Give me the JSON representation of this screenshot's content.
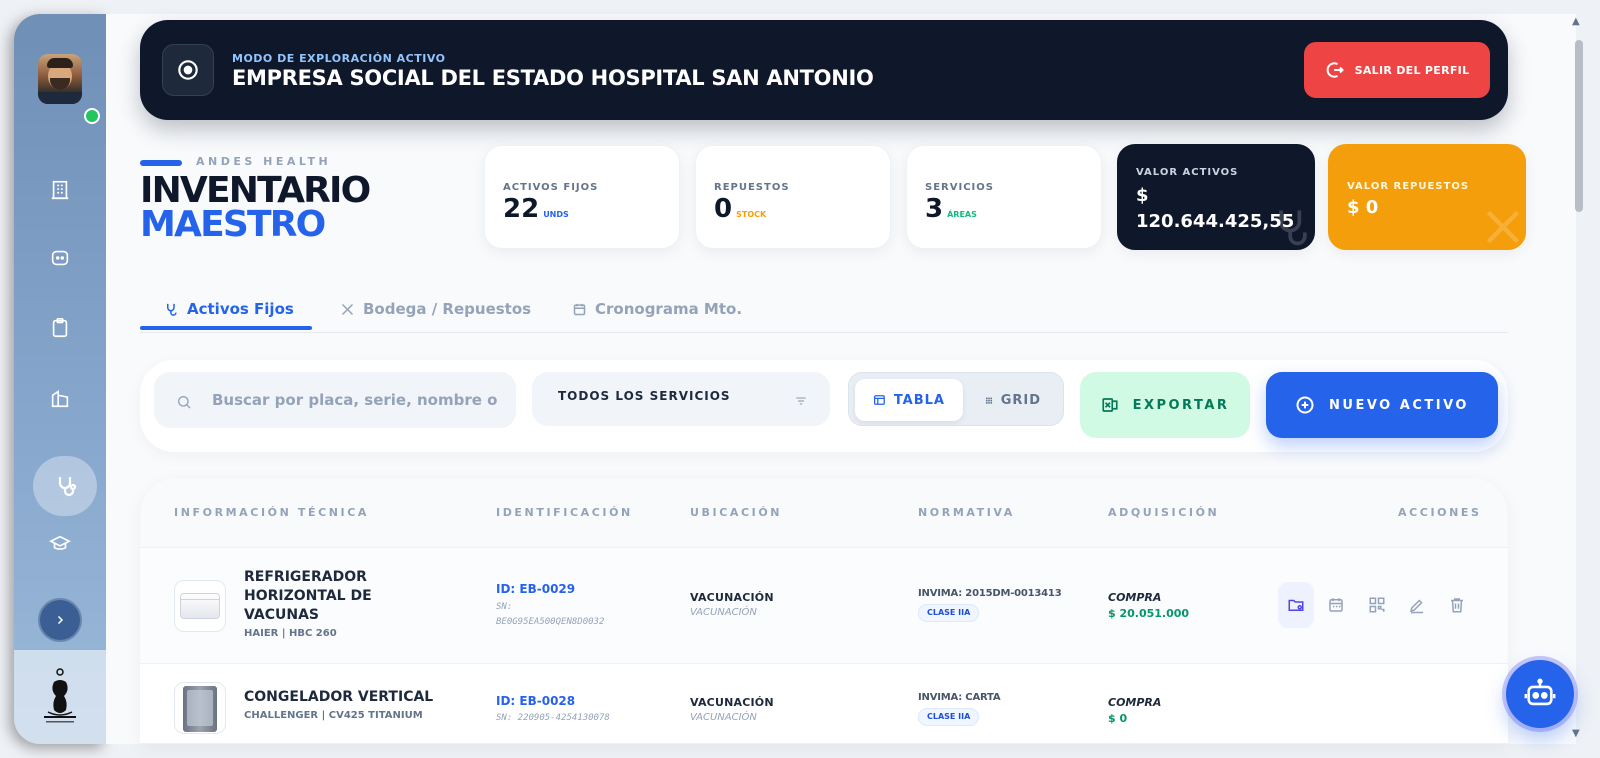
{
  "banner": {
    "mode_label": "MODO DE EXPLORACIÓN ACTIVO",
    "entity_name": "EMPRESA SOCIAL DEL ESTADO HOSPITAL SAN ANTONIO",
    "exit_label": "SALIR DEL PERFIL"
  },
  "header": {
    "brand": "ANDES HEALTH",
    "title_line1": "INVENTARIO",
    "title_line2": "MAESTRO"
  },
  "stats": [
    {
      "label": "ACTIVOS FIJOS",
      "value": "22",
      "unit": "UNDS",
      "unit_color": "#2563eb"
    },
    {
      "label": "REPUESTOS",
      "value": "0",
      "unit": "STOCK",
      "unit_color": "#f59e0b"
    },
    {
      "label": "SERVICIOS",
      "value": "3",
      "unit": "ÁREAS",
      "unit_color": "#10b981"
    },
    {
      "label": "VALOR ACTIVOS",
      "value_line1": "$",
      "value_line2": "120.644.425,55"
    },
    {
      "label": "VALOR REPUESTOS",
      "value": "$ 0"
    }
  ],
  "tabs": [
    {
      "label": "Activos Fijos",
      "icon": "stethoscope-icon",
      "active": true
    },
    {
      "label": "Bodega / Repuestos",
      "icon": "tools-icon",
      "active": false
    },
    {
      "label": "Cronograma Mto.",
      "icon": "calendar-icon",
      "active": false
    }
  ],
  "toolbar": {
    "search_placeholder": "Buscar por placa, serie, nombre o modelo...",
    "service_filter": "TODOS LOS SERVICIOS",
    "view_table": "TABLA",
    "view_grid": "GRID",
    "export_label": "EXPORTAR",
    "new_label": "NUEVO ACTIVO"
  },
  "table": {
    "columns": [
      "INFORMACIÓN TÉCNICA",
      "IDENTIFICACIÓN",
      "UBICACIÓN",
      "NORMATIVA",
      "ADQUISICIÓN",
      "ACCIONES"
    ],
    "rows": [
      {
        "name_lines": [
          "REFRIGERADOR",
          "HORIZONTAL DE",
          "VACUNAS"
        ],
        "brand_model": "HAIER | HBC 260",
        "id": "ID: EB-0029",
        "sn_label": "SN:",
        "sn": "BE0G95EA500QEN8D0032",
        "location": "VACUNACIÓN",
        "location_sub": "VACUNACIÓN",
        "invima": "INVIMA: 2015DM-0013413",
        "risk_class": "CLASE IIA",
        "acquisition": "COMPRA",
        "price": "$ 20.051.000"
      },
      {
        "name_lines": [
          "CONGELADOR VERTICAL"
        ],
        "brand_model": "CHALLENGER | CV425 TITANIUM",
        "id": "ID: EB-0028",
        "sn": "SN: 220905-4254130078",
        "location": "VACUNACIÓN",
        "location_sub": "VACUNACIÓN",
        "invima": "INVIMA: CARTA",
        "risk_class": "CLASE IIA",
        "acquisition": "COMPRA",
        "price": "$ 0"
      }
    ]
  },
  "colors": {
    "primary": "#2563eb",
    "navy": "#0f172a",
    "danger": "#ef4444",
    "warning": "#f59e0b",
    "success": "#059669"
  }
}
